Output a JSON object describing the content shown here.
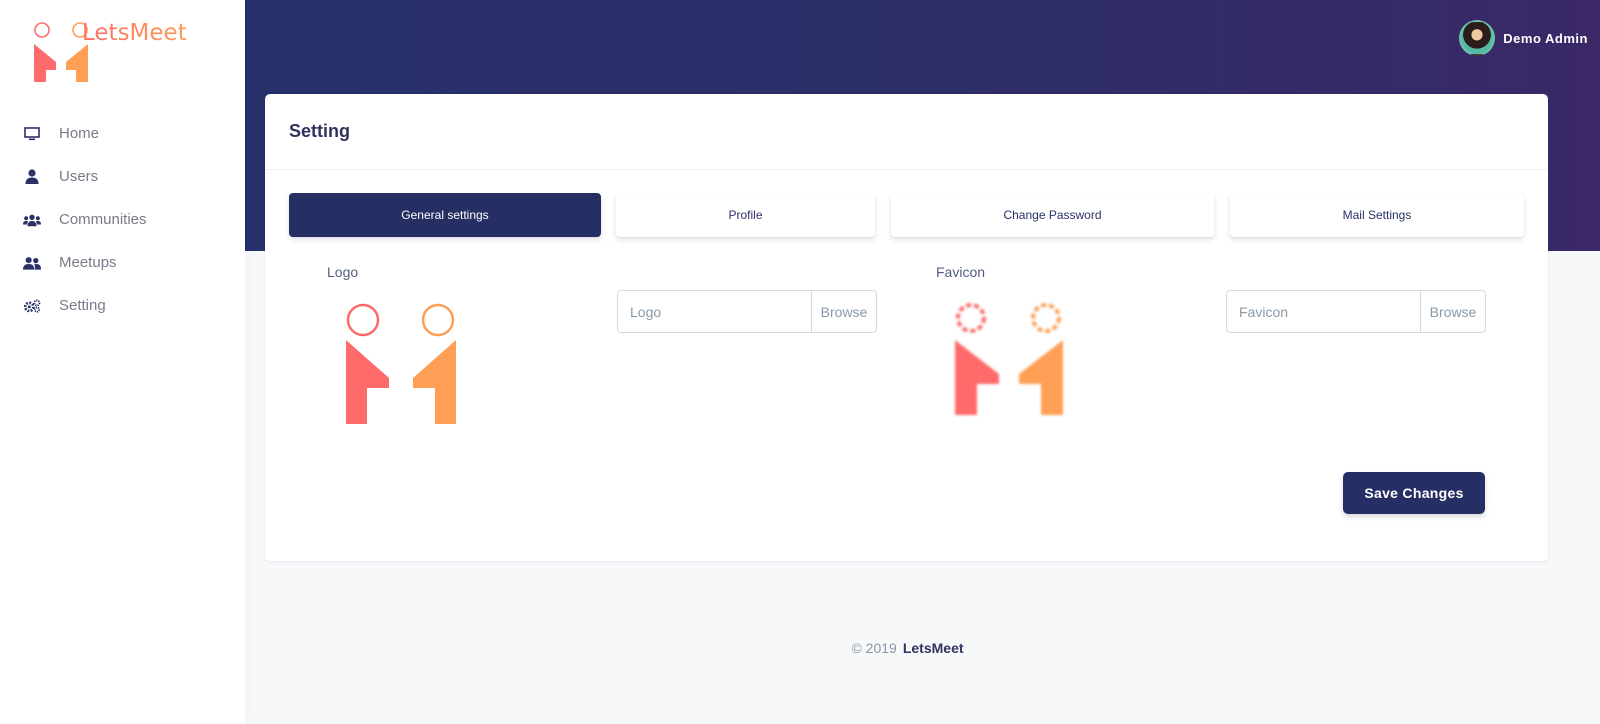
{
  "app": {
    "brand_name": "LetsMeet",
    "brand_colors": {
      "gradient_start": "#ff6b6b",
      "gradient_end": "#ff9f55"
    }
  },
  "sidebar": {
    "items": [
      {
        "label": "Home",
        "icon": "monitor-icon"
      },
      {
        "label": "Users",
        "icon": "user-icon"
      },
      {
        "label": "Communities",
        "icon": "users-group-icon"
      },
      {
        "label": "Meetups",
        "icon": "user-friends-icon"
      },
      {
        "label": "Setting",
        "icon": "gears-icon"
      }
    ]
  },
  "header": {
    "user_name": "Demo Admin",
    "accent": "#27306a"
  },
  "card": {
    "title": "Setting",
    "tabs": [
      {
        "label": "General settings",
        "active": true
      },
      {
        "label": "Profile",
        "active": false
      },
      {
        "label": "Change Password",
        "active": false
      },
      {
        "label": "Mail Settings",
        "active": false
      }
    ],
    "logo": {
      "label": "Logo",
      "placeholder": "Logo",
      "browse_label": "Browse"
    },
    "favicon": {
      "label": "Favicon",
      "placeholder": "Favicon",
      "browse_label": "Browse"
    },
    "save_label": "Save Changes"
  },
  "footer": {
    "copyright": "© 2019",
    "brand": "LetsMeet"
  }
}
